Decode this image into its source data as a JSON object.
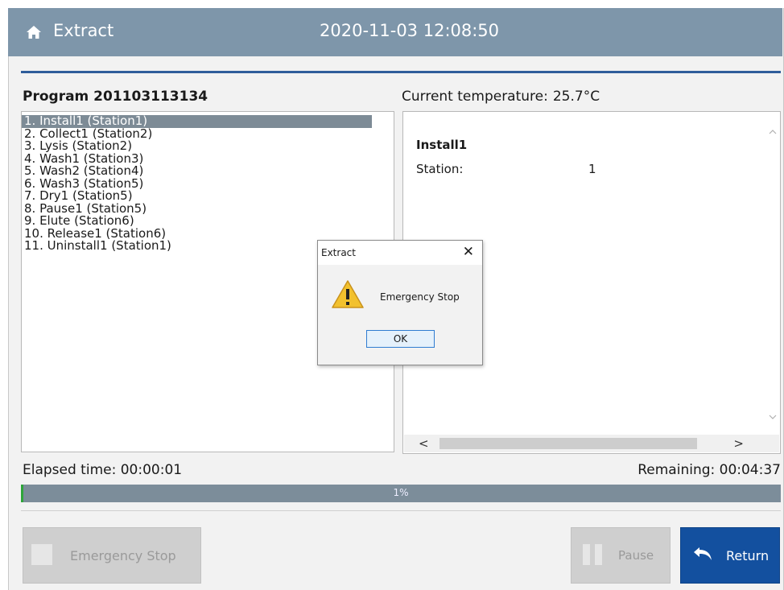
{
  "header": {
    "title": "Extract",
    "datetime": "2020-11-03 12:08:50",
    "home_icon": "home-icon"
  },
  "program": {
    "title": "Program 201103113134",
    "temperature_label": "Current temperature:",
    "temperature_value": "25.7°C",
    "steps": [
      "1. Install1 (Station1)",
      "2. Collect1 (Station2)",
      "3. Lysis (Station2)",
      "4. Wash1 (Station3)",
      "5. Wash2 (Station4)",
      "6. Wash3 (Station5)",
      "7. Dry1 (Station5)",
      "8. Pause1 (Station5)",
      "9. Elute (Station6)",
      "10. Release1 (Station6)",
      "11. Uninstall1 (Station1)"
    ],
    "selected_step_index": 0
  },
  "details": {
    "step_name": "Install1",
    "station_label": "Station:",
    "station_value": "1"
  },
  "status": {
    "elapsed": "Elapsed time: 00:00:01",
    "remaining": "Remaining: 00:04:37",
    "progress_text": "1%",
    "progress_fraction": 0.01,
    "progress_color": "#2ea53a"
  },
  "buttons": {
    "emergency_stop": "Emergency Stop",
    "pause": "Pause",
    "return": "Return"
  },
  "dialog": {
    "title": "Extract",
    "close": "✕",
    "message": "Emergency Stop",
    "ok": "OK",
    "icon": "warning-icon"
  },
  "colors": {
    "header": "#7e96aa",
    "accent_line": "#2f5d9b",
    "return_button": "#13509f",
    "selected_row": "#7d8b96"
  }
}
